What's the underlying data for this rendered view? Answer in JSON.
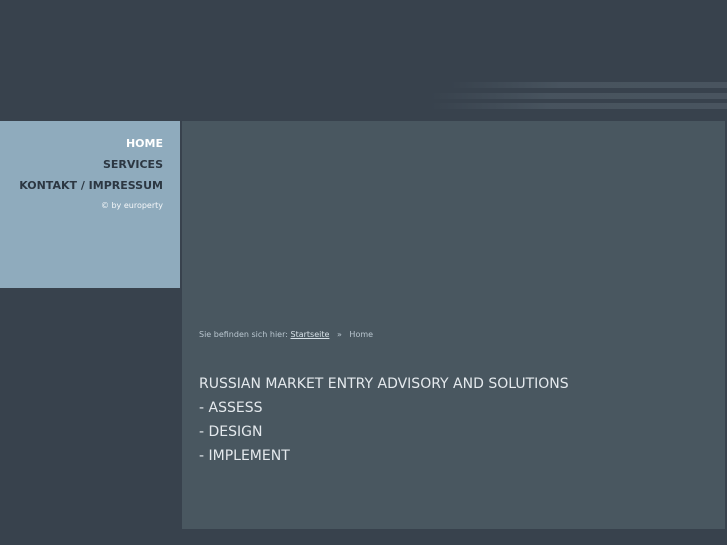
{
  "nav": {
    "items": [
      {
        "label": "HOME",
        "active": true
      },
      {
        "label": "SERVICES",
        "active": false
      },
      {
        "label": "KONTAKT / IMPRESSUM",
        "active": false
      }
    ],
    "copyright": "© by europerty"
  },
  "breadcrumb": {
    "prefix": "Sie befinden sich hier:",
    "link": "Startseite",
    "separator": "»",
    "current": "Home"
  },
  "content": {
    "headline": "RUSSIAN MARKET ENTRY ADVISORY AND SOLUTIONS",
    "items": [
      "- ASSESS",
      "- DESIGN",
      "- IMPLEMENT"
    ]
  },
  "colors": {
    "background": "#38424d",
    "sidebar": "#8fabbd",
    "main_panel": "#495760"
  }
}
